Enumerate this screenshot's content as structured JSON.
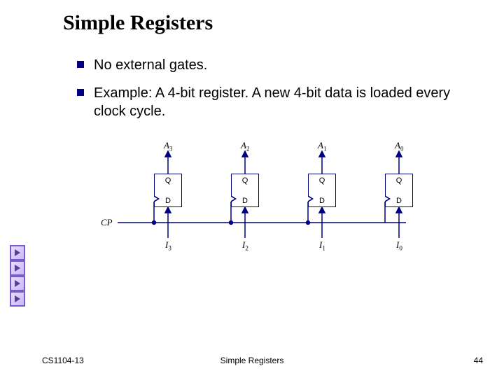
{
  "title": "Simple Registers",
  "bullets": [
    "No external gates.",
    "Example: A 4-bit register.  A new 4-bit data is loaded every clock cycle."
  ],
  "diagram": {
    "cp_label": "CP",
    "ff_internal": {
      "q": "Q",
      "d": "D"
    },
    "outputs": [
      {
        "base": "A",
        "sub": "3"
      },
      {
        "base": "A",
        "sub": "2"
      },
      {
        "base": "A",
        "sub": "1"
      },
      {
        "base": "A",
        "sub": "0"
      }
    ],
    "inputs": [
      {
        "base": "I",
        "sub": "3"
      },
      {
        "base": "I",
        "sub": "2"
      },
      {
        "base": "I",
        "sub": "1"
      },
      {
        "base": "I",
        "sub": "0"
      }
    ]
  },
  "footer": {
    "left": "CS1104-13",
    "center": "Simple Registers",
    "right": "44"
  }
}
